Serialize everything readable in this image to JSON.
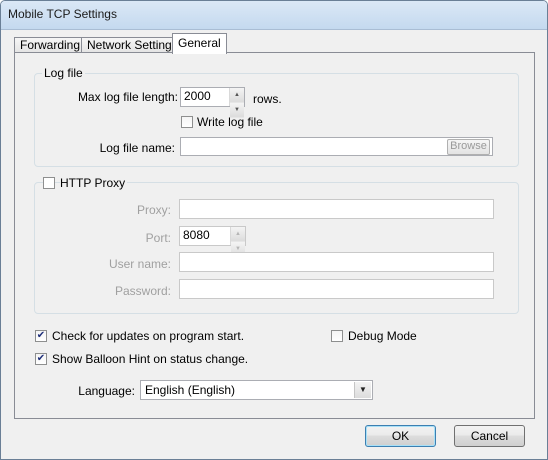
{
  "window": {
    "title": "Mobile TCP Settings"
  },
  "tabs": [
    {
      "label": "Forwarding"
    },
    {
      "label": "Network Settings"
    },
    {
      "label": "General"
    }
  ],
  "log_file": {
    "legend": "Log file",
    "max_length_label": "Max log file length:",
    "max_length_value": "2000",
    "rows_label": "rows.",
    "write_log_label": "Write log file",
    "write_log_checked": false,
    "file_name_label": "Log file name:",
    "file_name_value": "",
    "browse_label": "Browse"
  },
  "http_proxy": {
    "legend": "HTTP Proxy",
    "enabled": false,
    "proxy_label": "Proxy:",
    "proxy_value": "",
    "port_label": "Port:",
    "port_value": "8080",
    "username_label": "User name:",
    "username_value": "",
    "password_label": "Password:",
    "password_value": ""
  },
  "options": {
    "check_updates_label": "Check for updates on program start.",
    "check_updates_checked": true,
    "debug_mode_label": "Debug Mode",
    "debug_mode_checked": false,
    "balloon_hint_label": "Show Balloon Hint on status change.",
    "balloon_hint_checked": true
  },
  "language": {
    "label": "Language:",
    "value": "English (English)"
  },
  "buttons": {
    "ok": "OK",
    "cancel": "Cancel"
  }
}
